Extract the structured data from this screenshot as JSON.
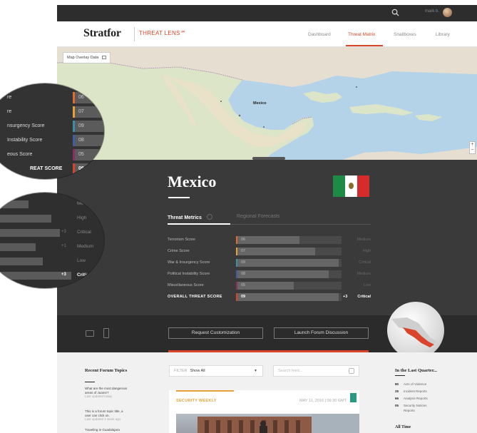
{
  "topbar": {
    "user_label": "mark b.",
    "colors": {
      "bg": "#2d2d2d"
    }
  },
  "header": {
    "logo": "Stratfor",
    "product": "THREAT LENS℠",
    "nav": [
      {
        "label": "Dashboard",
        "active": false
      },
      {
        "label": "Threat Matrix",
        "active": true
      },
      {
        "label": "Snailboxes",
        "active": false
      },
      {
        "label": "Library",
        "active": false
      }
    ],
    "accent": "#d9452b"
  },
  "map": {
    "overlay_button": "Map Overlay Data",
    "country_label": "Mexico",
    "zoom_in": "+",
    "zoom_out": "−"
  },
  "country": {
    "name": "Mexico",
    "flag_colors": [
      "#1f8a46",
      "#ffffff",
      "#d52b2b"
    ],
    "tabs": [
      {
        "label": "Threat Metrics",
        "active": true
      },
      {
        "label": "Regional Forecasts",
        "active": false
      }
    ]
  },
  "metrics": [
    {
      "label": "Terrorism Score",
      "value": "06",
      "fill": 0.6,
      "risk": "Medium",
      "delta": "",
      "color": "#e06b2b"
    },
    {
      "label": "Crime Score",
      "value": "07",
      "fill": 0.75,
      "risk": "High",
      "delta": "",
      "color": "#e8a13a"
    },
    {
      "label": "War & Insurgency Score",
      "value": "09",
      "fill": 0.97,
      "risk": "Critical",
      "delta": "",
      "color": "#3d8fa8"
    },
    {
      "label": "Political Instability Score",
      "value": "08",
      "fill": 0.88,
      "risk": "Medium",
      "delta": "",
      "color": "#3e5fa3"
    },
    {
      "label": "Miscellaneous Score",
      "value": "05",
      "fill": 0.55,
      "risk": "Low",
      "delta": "",
      "color": "#8b2e66"
    },
    {
      "label": "OVERALL THREAT SCORE",
      "value": "09",
      "fill": 0.97,
      "risk": "Critical",
      "delta": "+3",
      "color": "#d9452b",
      "total": true
    }
  ],
  "lens_left": {
    "rows": [
      {
        "label": "re",
        "value": "06",
        "color": "#e06b2b"
      },
      {
        "label": "re",
        "value": "07",
        "color": "#e8a13a"
      },
      {
        "label": "nsurgency Score",
        "value": "09",
        "color": "#3d8fa8"
      },
      {
        "label": "Instability Score",
        "value": "08",
        "color": "#3e5fa3"
      },
      {
        "label": "eous Score",
        "value": "05",
        "color": "#8b2e66"
      },
      {
        "label": "REAT SCORE",
        "value": "09",
        "color": "#d9452b",
        "total": true
      }
    ]
  },
  "lens_right": {
    "rows": [
      {
        "risk": "Med",
        "delta": ""
      },
      {
        "risk": "High",
        "delta": ""
      },
      {
        "risk": "Critical",
        "delta": "+3"
      },
      {
        "risk": "Medium",
        "delta": "+1"
      },
      {
        "risk": "Low",
        "delta": ""
      },
      {
        "risk": "Critic",
        "delta": "+3",
        "total": true
      }
    ]
  },
  "actions": {
    "request": "Request Customization",
    "launch": "Launch Forum Discussion"
  },
  "forum": {
    "title": "Recent Forum Topics",
    "items": [
      {
        "text": "What are the most dangerous areas of Juarez?",
        "sub": "Last updated today"
      },
      {
        "text": "This is a forum topic title, a user can click on.",
        "sub": "Last updated 1 week ago"
      },
      {
        "text": "Traveling in Guadalajara",
        "sub": ""
      }
    ]
  },
  "filter": {
    "label": "FILTER",
    "value": "Show All",
    "search_placeholder": "Search feed..."
  },
  "card": {
    "tag": "SECURITY WEEKLY",
    "date": "MAY 11, 2016 | 09:30 GMT"
  },
  "quarter": {
    "title": "In the Last Quarter...",
    "rows": [
      {
        "count": "80",
        "label": "Acts of Violence"
      },
      {
        "count": "25",
        "label": "Incident Reports"
      },
      {
        "count": "66",
        "label": "Analysis Reports"
      },
      {
        "count": "05",
        "label": "Security Notices"
      }
    ],
    "extra": "Reports",
    "all_time": "All Time"
  }
}
